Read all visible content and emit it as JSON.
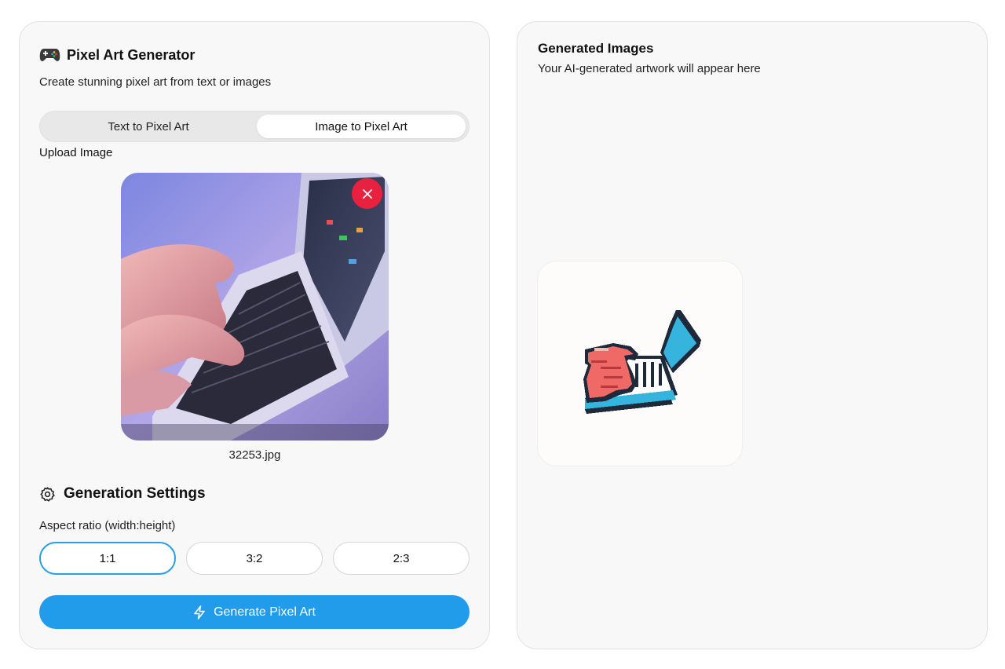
{
  "app": {
    "title": "Pixel Art Generator",
    "subtitle": "Create stunning pixel art from text or images",
    "icon": "gamepad-icon"
  },
  "tabs": [
    {
      "label": "Text to Pixel Art",
      "active": false
    },
    {
      "label": "Image to Pixel Art",
      "active": true
    }
  ],
  "upload": {
    "label": "Upload Image",
    "filename": "32253.jpg"
  },
  "settings": {
    "title": "Generation Settings",
    "aspect_label": "Aspect ratio (width:height)",
    "aspect_options": [
      "1:1",
      "3:2",
      "2:3"
    ],
    "aspect_selected": "1:1"
  },
  "generate_button": {
    "label": "Generate Pixel Art",
    "color": "#219ceb"
  },
  "results": {
    "title": "Generated Images",
    "subtitle": "Your AI-generated artwork will appear here"
  },
  "colors": {
    "accent": "#219ceb",
    "remove": "#e8213f"
  }
}
